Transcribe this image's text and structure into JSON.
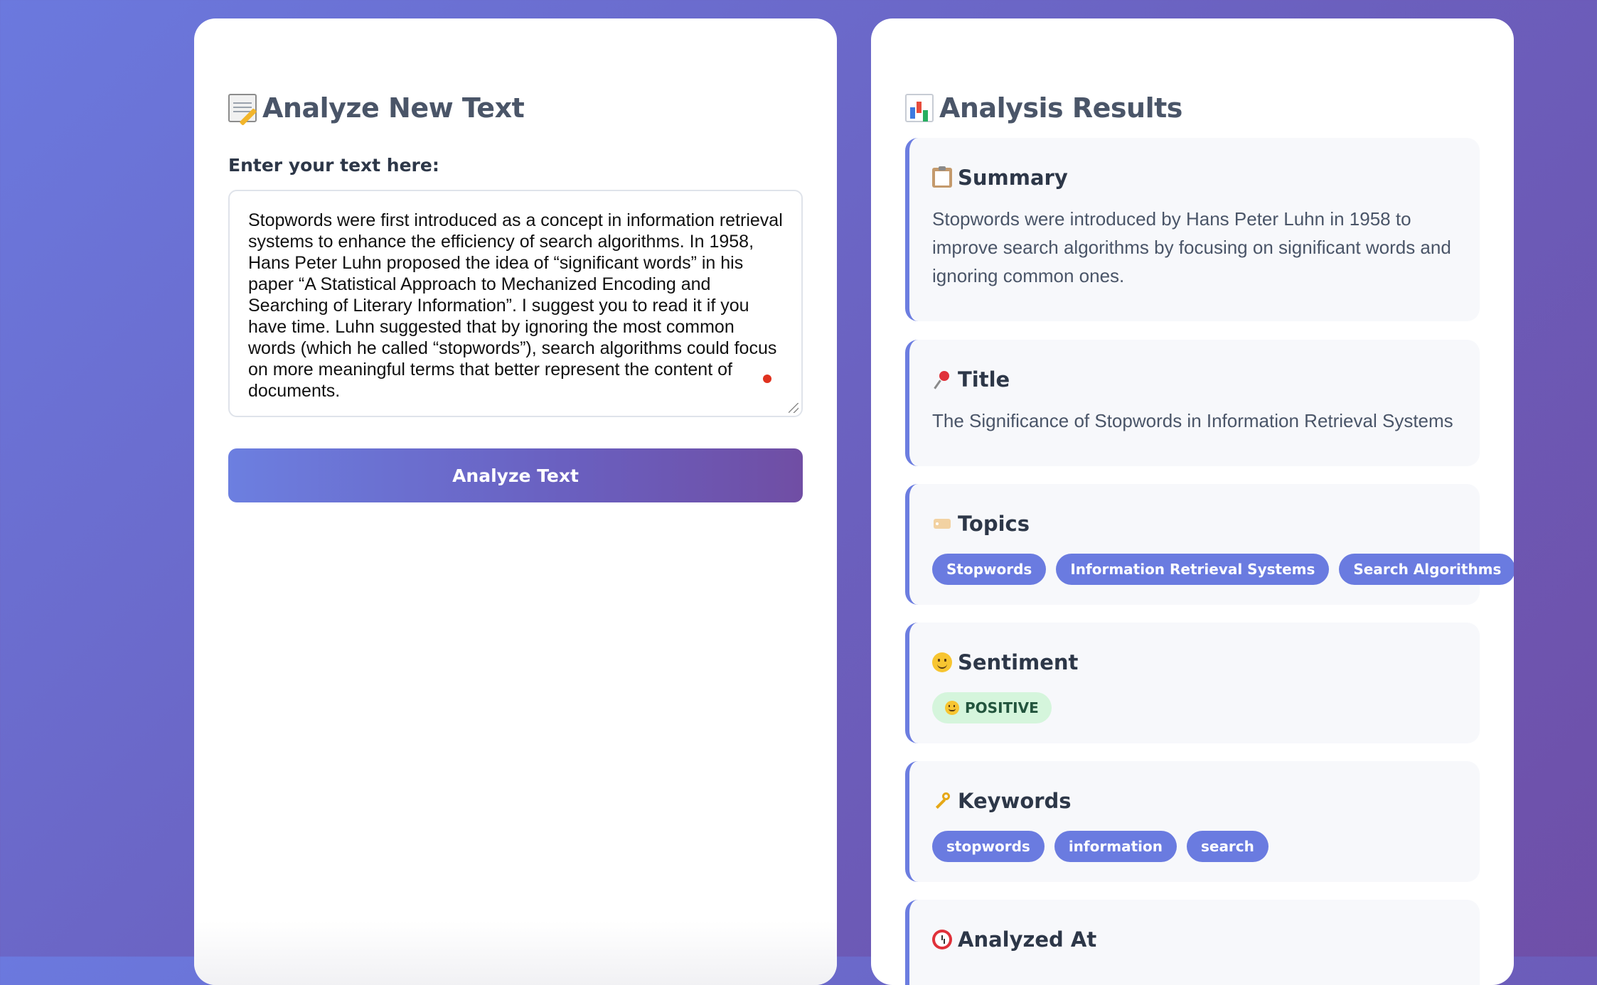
{
  "analyze_panel": {
    "title": "Analyze New Text",
    "title_icon": "memo-icon",
    "field_label": "Enter your text here:",
    "text_value": "Stopwords were first introduced as a concept in information retrieval systems to enhance the efficiency of search algorithms. In 1958, Hans Peter Luhn proposed the idea of “significant words” in his paper “A Statistical Approach to Mechanized Encoding and Searching of Literary Information”. I suggest you to read it if you have time. Luhn suggested that by ignoring the most common words (which he called “stopwords”), search algorithms could focus on more meaningful terms that better represent the content of documents.",
    "button_label": "Analyze Text"
  },
  "results_panel": {
    "title": "Analysis Results",
    "title_icon": "bar-chart-icon",
    "summary": {
      "heading": "Summary",
      "icon": "clipboard-icon",
      "text": "Stopwords were introduced by Hans Peter Luhn in 1958 to improve search algorithms by focusing on significant words and ignoring common ones."
    },
    "title_section": {
      "heading": "Title",
      "icon": "pushpin-icon",
      "text": "The Significance of Stopwords in Information Retrieval Systems"
    },
    "topics": {
      "heading": "Topics",
      "icon": "label-tag-icon",
      "items": [
        "Stopwords",
        "Information Retrieval Systems",
        "Search Algorithms"
      ]
    },
    "sentiment": {
      "heading": "Sentiment",
      "icon": "smiley-icon",
      "value": "POSITIVE"
    },
    "keywords": {
      "heading": "Keywords",
      "icon": "key-icon",
      "items": [
        "stopwords",
        "information",
        "search"
      ]
    },
    "analyzed_at": {
      "heading": "Analyzed At",
      "icon": "alarm-clock-icon"
    }
  },
  "colors": {
    "accent": "#6a7be0",
    "heading_text": "#2d3748",
    "positive_badge_bg": "#d5f5dc",
    "positive_badge_text": "#22543d"
  }
}
